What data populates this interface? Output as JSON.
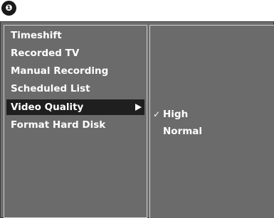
{
  "step_badge": "❶",
  "menu": {
    "items": [
      {
        "label": "Timeshift"
      },
      {
        "label": "Recorded TV"
      },
      {
        "label": "Manual Recording"
      },
      {
        "label": "Scheduled List"
      },
      {
        "label": "Video Quality",
        "selected": true,
        "has_submenu": true
      },
      {
        "label": "Format Hard Disk"
      }
    ]
  },
  "submenu": {
    "items": [
      {
        "label": "High",
        "checked": true,
        "check_glyph": "✓"
      },
      {
        "label": "Normal",
        "checked": false
      }
    ]
  },
  "colors": {
    "panel_bg": "#6b6b6b",
    "selected_bg": "#1f1f1f",
    "text": "#ffffff",
    "border": "#cfcfcf"
  },
  "icons": {
    "submenu_arrow": "right-triangle-icon",
    "check": "checkmark-icon",
    "step": "circled-number-one-icon"
  }
}
